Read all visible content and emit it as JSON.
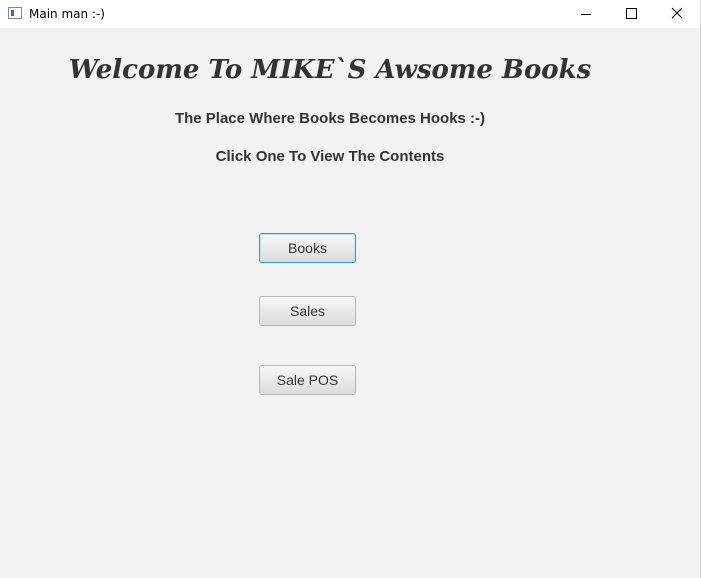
{
  "window": {
    "title": "Main man :-)",
    "controls": [
      "minimize-icon",
      "maximize-icon",
      "close-icon"
    ]
  },
  "main": {
    "title": "Welcome To MIKE`S Awsome Books",
    "subtitle": "The Place Where Books Becomes Hooks :-)",
    "instruction": "Click One To View The Contents"
  },
  "buttons": {
    "books": "Books",
    "sales": "Sales",
    "sale_pos": "Sale POS"
  },
  "colors": {
    "background": "#f2f2f2",
    "titlebar": "#ffffff",
    "text": "#333333",
    "focus_border": "#2a9fd6"
  }
}
